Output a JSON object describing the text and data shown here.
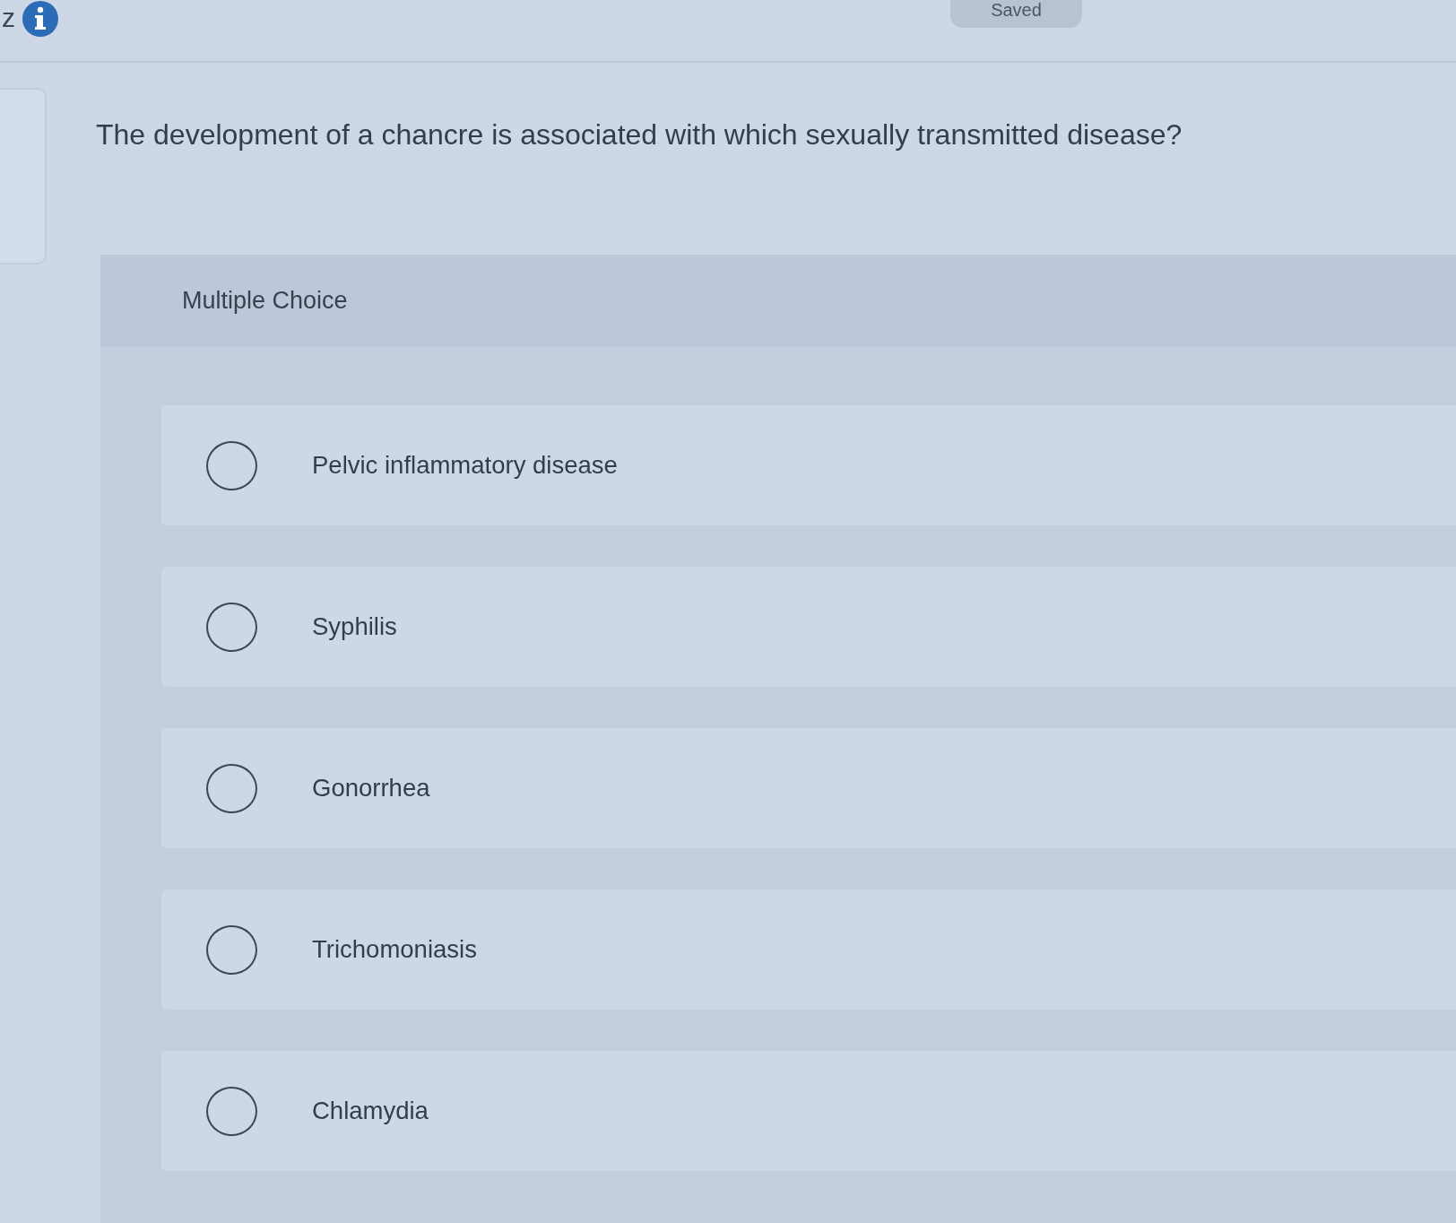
{
  "top_bar": {
    "letter": "z",
    "saved_label": "Saved"
  },
  "question": {
    "text": "The development of a chancre is associated with which sexually transmitted disease?"
  },
  "answer_panel": {
    "type_label": "Multiple Choice",
    "choices": [
      {
        "label": "Pelvic inflammatory disease",
        "selected": false
      },
      {
        "label": "Syphilis",
        "selected": false
      },
      {
        "label": "Gonorrhea",
        "selected": false
      },
      {
        "label": "Trichomoniasis",
        "selected": false
      },
      {
        "label": "Chlamydia",
        "selected": false
      }
    ]
  }
}
